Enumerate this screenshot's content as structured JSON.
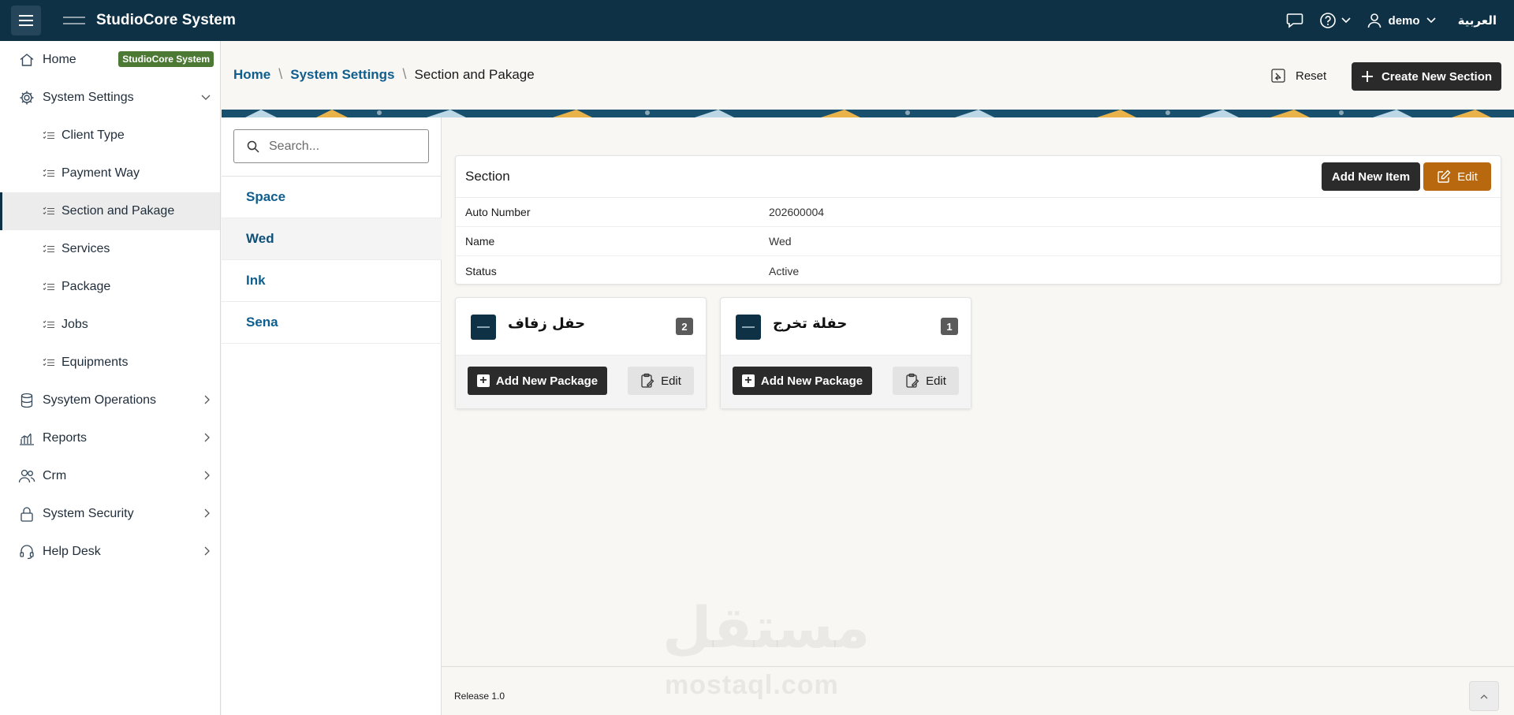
{
  "header": {
    "app_title": "StudioCore System",
    "user_name": "demo",
    "language_link": "العربية"
  },
  "sidebar": {
    "home_label": "Home",
    "home_badge": "StudioCore System",
    "settings_label": "System Settings",
    "sub_items": [
      {
        "label": "Client Type"
      },
      {
        "label": "Payment Way"
      },
      {
        "label": "Section and Pakage"
      },
      {
        "label": "Services"
      },
      {
        "label": "Package"
      },
      {
        "label": "Jobs"
      },
      {
        "label": "Equipments"
      }
    ],
    "groups": [
      {
        "label": "Sysytem Operations"
      },
      {
        "label": "Reports"
      },
      {
        "label": "Crm"
      },
      {
        "label": "System Security"
      },
      {
        "label": "Help Desk"
      }
    ]
  },
  "breadcrumb": {
    "items": [
      "Home",
      "System Settings"
    ],
    "current": "Section and Pakage"
  },
  "toolbar": {
    "reset_label": "Reset",
    "create_label": "Create New Section"
  },
  "search": {
    "placeholder": "Search..."
  },
  "section_list": [
    {
      "label": "Space"
    },
    {
      "label": "Wed"
    },
    {
      "label": "Ink"
    },
    {
      "label": "Sena"
    }
  ],
  "section_card": {
    "title": "Section",
    "add_item_label": "Add New Item",
    "edit_label": "Edit",
    "fields": [
      {
        "key": "Auto Number",
        "value": "202600004"
      },
      {
        "key": "Name",
        "value": "Wed"
      },
      {
        "key": "Status",
        "value": "Active"
      }
    ]
  },
  "packages": [
    {
      "name": "حفل زفاف",
      "count": "2",
      "add_label": "Add New Package",
      "edit_label": "Edit"
    },
    {
      "name": "حفلة تخرج",
      "count": "1",
      "add_label": "Add New Package",
      "edit_label": "Edit"
    }
  ],
  "footer": {
    "release": "Release 1.0"
  },
  "watermark": {
    "arabic": "مستقل",
    "latin": "mostaql.com"
  },
  "colors": {
    "header_bg": "#0e3145",
    "badge_green": "#4c7a34",
    "link_blue": "#0e5e8e",
    "edit_orange": "#b8680f",
    "dark_button": "#2b2b2b"
  },
  "icons": {
    "menu": "hamburger-icon",
    "chat": "chat-icon",
    "help": "help-icon",
    "user": "user-icon",
    "search": "search-icon",
    "reset": "reset-icon",
    "add": "plus-icon",
    "edit": "edit-icon",
    "clipboard": "clipboard-icon"
  }
}
